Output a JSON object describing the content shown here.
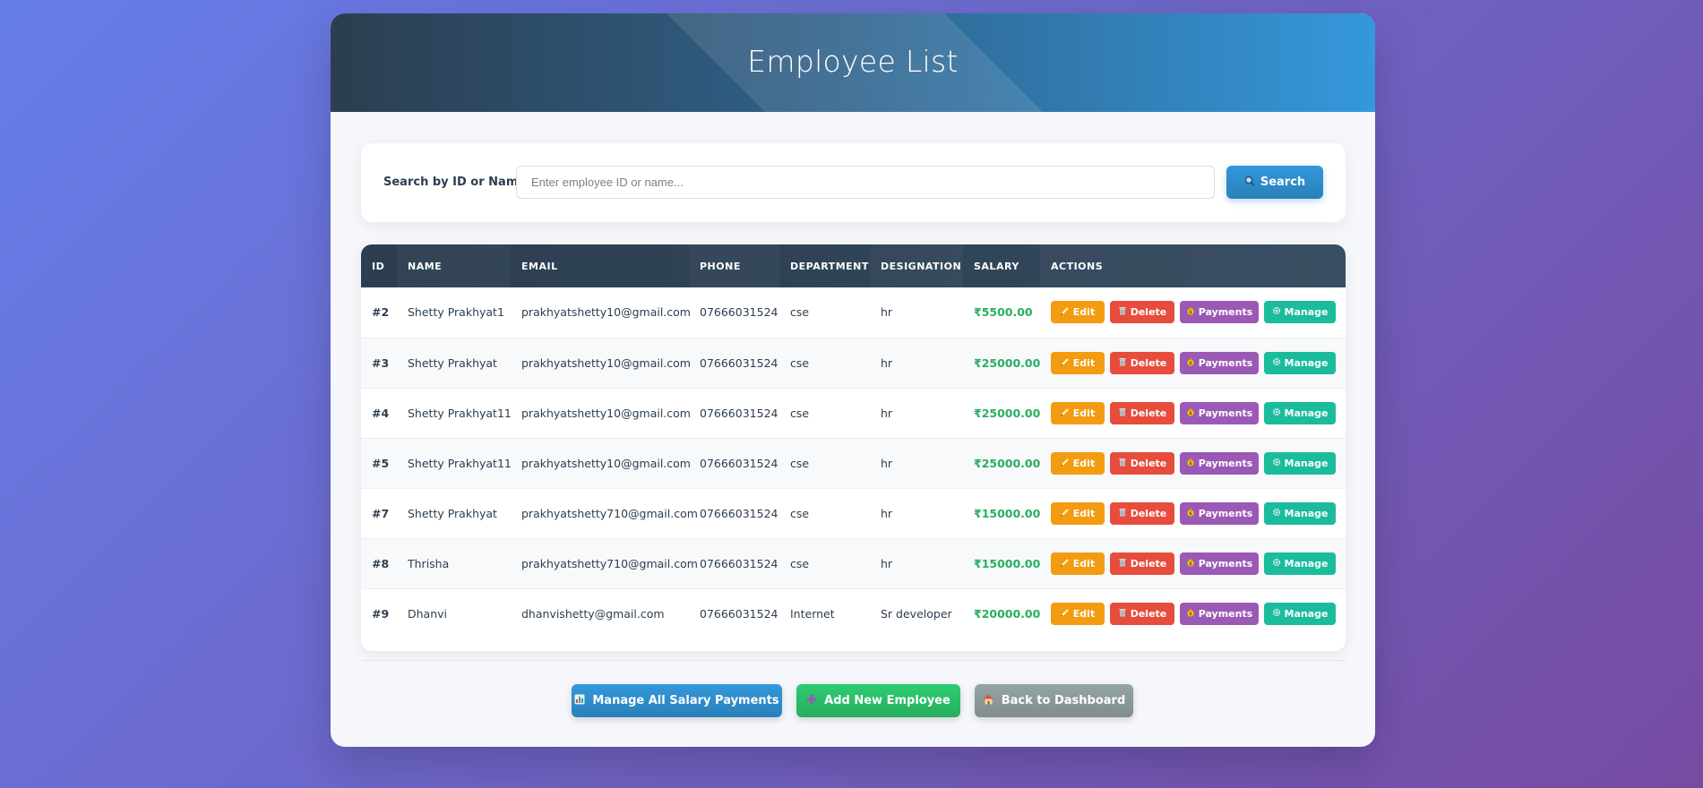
{
  "header": {
    "title": "Employee List"
  },
  "search": {
    "label": "Search by ID or Name:",
    "placeholder": "Enter employee ID or name...",
    "button_label": "Search"
  },
  "table": {
    "columns": [
      "ID",
      "NAME",
      "EMAIL",
      "PHONE",
      "DEPARTMENT",
      "DESIGNATION",
      "SALARY",
      "ACTIONS"
    ],
    "rows": [
      {
        "id": "#2",
        "name": "Shetty Prakhyat1",
        "email": "prakhyatshetty10@gmail.com",
        "phone": "07666031524",
        "department": "cse",
        "designation": "hr",
        "salary": "₹5500.00"
      },
      {
        "id": "#3",
        "name": "Shetty Prakhyat",
        "email": "prakhyatshetty10@gmail.com",
        "phone": "07666031524",
        "department": "cse",
        "designation": "hr",
        "salary": "₹25000.00"
      },
      {
        "id": "#4",
        "name": "Shetty Prakhyat11",
        "email": "prakhyatshetty10@gmail.com",
        "phone": "07666031524",
        "department": "cse",
        "designation": "hr",
        "salary": "₹25000.00"
      },
      {
        "id": "#5",
        "name": "Shetty Prakhyat11",
        "email": "prakhyatshetty10@gmail.com",
        "phone": "07666031524",
        "department": "cse",
        "designation": "hr",
        "salary": "₹25000.00"
      },
      {
        "id": "#7",
        "name": "Shetty Prakhyat",
        "email": "prakhyatshetty710@gmail.com",
        "phone": "07666031524",
        "department": "cse",
        "designation": "hr",
        "salary": "₹15000.00"
      },
      {
        "id": "#8",
        "name": "Thrisha",
        "email": "prakhyatshetty710@gmail.com",
        "phone": "07666031524",
        "department": "cse",
        "designation": "hr",
        "salary": "₹15000.00"
      },
      {
        "id": "#9",
        "name": "Dhanvi",
        "email": "dhanvishetty@gmail.com",
        "phone": "07666031524",
        "department": "Internet",
        "designation": "Sr developer",
        "salary": "₹20000.00"
      }
    ],
    "actions": {
      "edit": "Edit",
      "delete": "Delete",
      "payments": "Payments",
      "manage": "Manage"
    }
  },
  "footer": {
    "manage_salary_label": "Manage All Salary Payments",
    "add_employee_label": "Add New Employee",
    "back_label": "Back to Dashboard"
  },
  "colors": {
    "accent": "#3498db",
    "salary": "#27ae60",
    "edit": "#f39c12",
    "delete": "#e74c3c",
    "payments": "#9b59b6",
    "manage": "#1abc9c"
  },
  "icons": {
    "search": "magnifier-icon",
    "edit": "pencil-icon",
    "delete": "trash-icon",
    "payments": "money-bag-icon",
    "manage": "gear-icon",
    "manage_salary": "chart-icon",
    "add_employee": "plus-icon",
    "back": "house-icon"
  }
}
